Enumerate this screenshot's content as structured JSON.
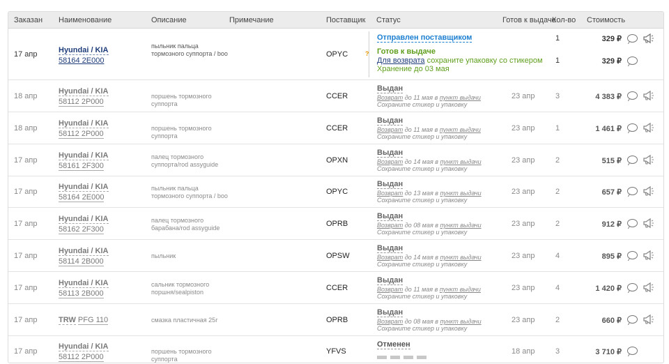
{
  "header": {
    "ordered": "Заказан",
    "name": "Наименование",
    "description": "Описание",
    "note": "Примечание",
    "supplier": "Поставщик",
    "status": "Статус",
    "ready": "Готов к выдаче",
    "qty": "Кол-во",
    "cost": "Стоимость"
  },
  "first_row": {
    "date": "17 апр",
    "brand": "Hyundai / KIA",
    "part": "58164 2E000",
    "description": "пыльник пальца тормозного суппорта / boo",
    "supplier": "OPYC",
    "qmark": "?",
    "status1": "Отправлен поставщиком",
    "qty1": "1",
    "cost1": "329 ₽",
    "status2": "Готов к выдаче",
    "return_link": "Для возврата",
    "return_text": " сохраните упаковку со стикером",
    "storage": "Хранение до 03 мая",
    "qty2": "1",
    "cost2": "329 ₽"
  },
  "rows": [
    {
      "date": "18 апр",
      "brand": "Hyundai / KIA",
      "part": "58112 2P000",
      "description": "поршень тормозного суппорта",
      "supplier": "CCER",
      "status": "Выдан",
      "ret_a": "Возврат",
      "ret_b": " до 11 мая в ",
      "ret_c": "пункт выдачи",
      "keep": "Сохраните стикер и упаковку",
      "ready": "23 апр",
      "qty": "3",
      "cost": "4 383 ₽",
      "horn": true
    },
    {
      "date": "18 апр",
      "brand": "Hyundai / KIA",
      "part": "58112 2P000",
      "description": "поршень тормозного суппорта",
      "supplier": "CCER",
      "status": "Выдан",
      "ret_a": "Возврат",
      "ret_b": " до 11 мая в ",
      "ret_c": "пункт выдачи",
      "keep": "Сохраните стикер и упаковку",
      "ready": "23 апр",
      "qty": "1",
      "cost": "1 461 ₽",
      "horn": true
    },
    {
      "date": "17 апр",
      "brand": "Hyundai / KIA",
      "part": "58161 2F300",
      "description": "палец тормозного суппорта/rod assyguide",
      "supplier": "OPXN",
      "status": "Выдан",
      "ret_a": "Возврат",
      "ret_b": " до 14 мая в ",
      "ret_c": "пункт выдачи",
      "keep": "Сохраните стикер и упаковку",
      "ready": "23 апр",
      "qty": "2",
      "cost": "515 ₽",
      "horn": true
    },
    {
      "date": "17 апр",
      "brand": "Hyundai / KIA",
      "part": "58164 2E000",
      "description": "пыльник пальца тормозного суппорта / boo",
      "supplier": "OPYC",
      "status": "Выдан",
      "ret_a": "Возврат",
      "ret_b": " до 13 мая в ",
      "ret_c": "пункт выдачи",
      "keep": "Сохраните стикер и упаковку",
      "ready": "23 апр",
      "qty": "2",
      "cost": "657 ₽",
      "horn": true
    },
    {
      "date": "17 апр",
      "brand": "Hyundai / KIA",
      "part": "58162 2F300",
      "description": "палец тормозного барабана/rod assyguide",
      "supplier": "OPRB",
      "status": "Выдан",
      "ret_a": "Возврат",
      "ret_b": " до 08 мая в ",
      "ret_c": "пункт выдачи",
      "keep": "Сохраните стикер и упаковку",
      "ready": "23 апр",
      "qty": "2",
      "cost": "912 ₽",
      "horn": true
    },
    {
      "date": "17 апр",
      "brand": "Hyundai / KIA",
      "part": "58114 2B000",
      "description": "пыльник",
      "supplier": "OPSW",
      "status": "Выдан",
      "ret_a": "Возврат",
      "ret_b": " до 14 мая в ",
      "ret_c": "пункт выдачи",
      "keep": "Сохраните стикер и упаковку",
      "ready": "23 апр",
      "qty": "4",
      "cost": "895 ₽",
      "horn": true
    },
    {
      "date": "17 апр",
      "brand": "Hyundai / KIA",
      "part": "58113 2B000",
      "description": "сальник тормозного поршня/sealpiston",
      "supplier": "CCER",
      "status": "Выдан",
      "ret_a": "Возврат",
      "ret_b": " до 11 мая в ",
      "ret_c": "пункт выдачи",
      "keep": "Сохраните стикер и упаковку",
      "ready": "23 апр",
      "qty": "4",
      "cost": "1 420 ₽",
      "horn": true
    },
    {
      "date": "17 апр",
      "brand": "TRW",
      "part": "PFG 110",
      "description": "смазка пластичная 25г",
      "supplier": "OPRB",
      "status": "Выдан",
      "ret_a": "Возврат",
      "ret_b": " до 08 мая в ",
      "ret_c": "пункт выдачи",
      "keep": "Сохраните стикер и упаковку",
      "ready": "23 апр",
      "qty": "2",
      "cost": "660 ₽",
      "horn": true
    },
    {
      "date": "17 апр",
      "brand": "Hyundai / KIA",
      "part": "58112 2P000",
      "description": "поршень тормозного суппорта",
      "supplier": "YFVS",
      "status": "Отменен",
      "cancelled": true,
      "ready": "18 апр",
      "qty": "3",
      "cost": "3 710 ₽",
      "horn": false
    }
  ]
}
